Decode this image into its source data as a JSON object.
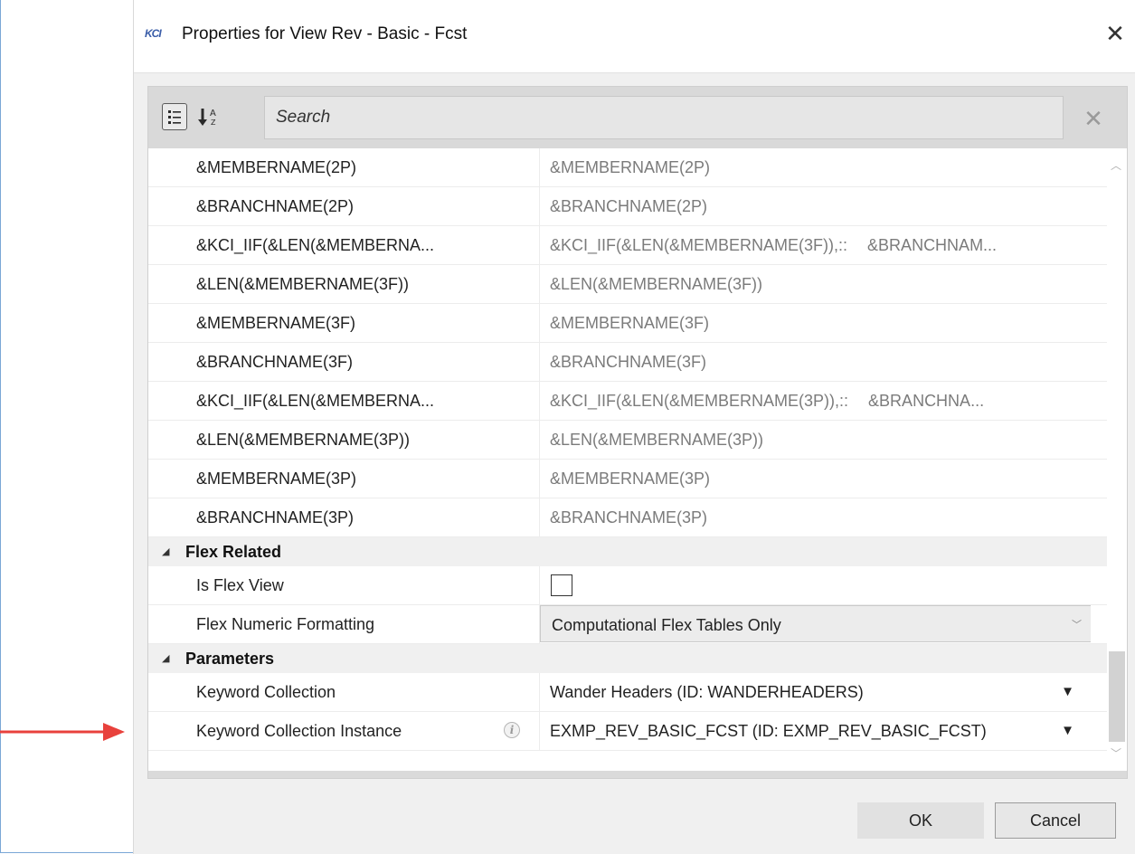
{
  "window": {
    "logo_text": "KCI",
    "title": "Properties for View Rev - Basic - Fcst",
    "close_glyph": "✕"
  },
  "toolbar": {
    "categorized_icon": "categorized-list-icon",
    "sort_icon": "sort-alphabetical-icon",
    "search_placeholder": "Search",
    "search_clear_glyph": "✕"
  },
  "keyword_rows": [
    {
      "name": "&MEMBERNAME(2P)",
      "value": "&MEMBERNAME(2P)",
      "value2": ""
    },
    {
      "name": "&BRANCHNAME(2P)",
      "value": "&BRANCHNAME(2P)",
      "value2": ""
    },
    {
      "name": "&KCI_IIF(&LEN(&MEMBERNA...",
      "value": "&KCI_IIF(&LEN(&MEMBERNAME(3F)),::",
      "value2": "&BRANCHNAM..."
    },
    {
      "name": "&LEN(&MEMBERNAME(3F))",
      "value": "&LEN(&MEMBERNAME(3F))",
      "value2": ""
    },
    {
      "name": "&MEMBERNAME(3F)",
      "value": "&MEMBERNAME(3F)",
      "value2": ""
    },
    {
      "name": "&BRANCHNAME(3F)",
      "value": "&BRANCHNAME(3F)",
      "value2": ""
    },
    {
      "name": "&KCI_IIF(&LEN(&MEMBERNA...",
      "value": "&KCI_IIF(&LEN(&MEMBERNAME(3P)),::",
      "value2": "&BRANCHNA..."
    },
    {
      "name": "&LEN(&MEMBERNAME(3P))",
      "value": "&LEN(&MEMBERNAME(3P))",
      "value2": ""
    },
    {
      "name": "&MEMBERNAME(3P)",
      "value": "&MEMBERNAME(3P)",
      "value2": ""
    },
    {
      "name": "&BRANCHNAME(3P)",
      "value": "&BRANCHNAME(3P)",
      "value2": ""
    }
  ],
  "flex_related": {
    "label": "Flex Related",
    "is_flex_view_label": "Is Flex View",
    "is_flex_view_checked": false,
    "numeric_formatting_label": "Flex Numeric Formatting",
    "numeric_formatting_value": "Computational Flex Tables Only"
  },
  "parameters": {
    "label": "Parameters",
    "keyword_collection_label": "Keyword Collection",
    "keyword_collection_value": "Wander Headers (ID: WANDERHEADERS)",
    "instance_label": "Keyword Collection Instance",
    "instance_info_icon": "info-icon",
    "instance_value": "EXMP_REV_BASIC_FCST (ID: EXMP_REV_BASIC_FCST)"
  },
  "buttons": {
    "ok_label": "OK",
    "cancel_label": "Cancel"
  },
  "colors": {
    "annotation_arrow": "#e8413c",
    "accent_frame": "#7aa7d6"
  }
}
